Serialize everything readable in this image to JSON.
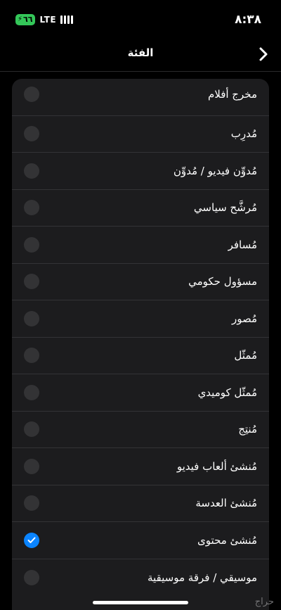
{
  "status_bar": {
    "time": "٨:٣٨",
    "battery_level": "٦٦",
    "network": "LTE",
    "battery_color": "#34c759"
  },
  "nav": {
    "title": "الفئة",
    "back_icon": "chevron-right-icon"
  },
  "items": [
    {
      "label": "مخرج أفلام",
      "checked": false
    },
    {
      "label": "مُدرِب",
      "checked": false
    },
    {
      "label": "مُدوِّن فيديو / مُدوِّن",
      "checked": false
    },
    {
      "label": "مُرشَّح سياسي",
      "checked": false
    },
    {
      "label": "مُسافر",
      "checked": false
    },
    {
      "label": "مسؤول حكومي",
      "checked": false
    },
    {
      "label": "مُصور",
      "checked": false
    },
    {
      "label": "مُمثّل",
      "checked": false
    },
    {
      "label": "مُمثّل كوميدي",
      "checked": false
    },
    {
      "label": "مُنتِج",
      "checked": false
    },
    {
      "label": "مُنشئ ألعاب فيديو",
      "checked": false
    },
    {
      "label": "مُنشئ العدسة",
      "checked": false
    },
    {
      "label": "مُنشئ محتوى",
      "checked": true
    },
    {
      "label": "موسيقي / فرقة موسيقية",
      "checked": false
    }
  ],
  "colors": {
    "background": "#000000",
    "card": "#1c1c1e",
    "selected": "#0a84ff",
    "unselected": "#333335"
  },
  "watermark": "حراج"
}
